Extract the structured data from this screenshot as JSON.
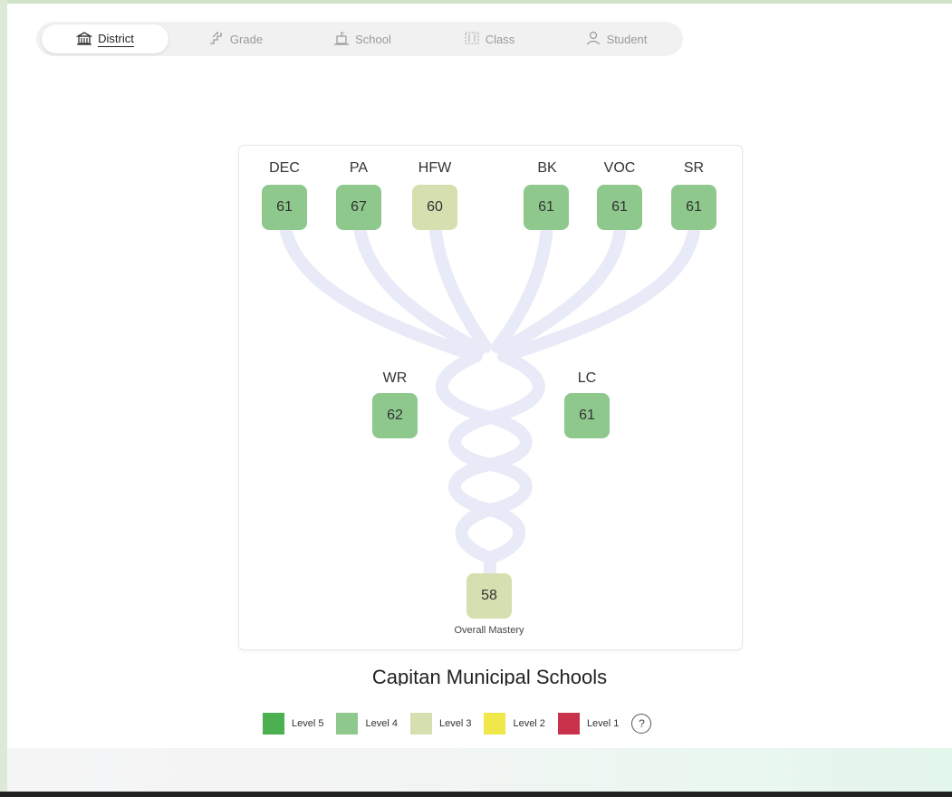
{
  "tabs": [
    {
      "id": "district",
      "label": "District",
      "icon": "building-icon",
      "active": true
    },
    {
      "id": "grade",
      "label": "Grade",
      "icon": "stairs-icon",
      "active": false
    },
    {
      "id": "school",
      "label": "School",
      "icon": "school-icon",
      "active": false
    },
    {
      "id": "class",
      "label": "Class",
      "icon": "class-icon",
      "active": false
    },
    {
      "id": "student",
      "label": "Student",
      "icon": "person-icon",
      "active": false
    }
  ],
  "tree": {
    "top_nodes": [
      {
        "label": "DEC",
        "value": "61",
        "level": 4
      },
      {
        "label": "PA",
        "value": "67",
        "level": 4
      },
      {
        "label": "HFW",
        "value": "60",
        "level": 3
      },
      {
        "label": "BK",
        "value": "61",
        "level": 4
      },
      {
        "label": "VOC",
        "value": "61",
        "level": 4
      },
      {
        "label": "SR",
        "value": "61",
        "level": 4
      }
    ],
    "mid_nodes": [
      {
        "label": "WR",
        "value": "62",
        "level": 4
      },
      {
        "label": "LC",
        "value": "61",
        "level": 4
      }
    ],
    "root": {
      "value": "58",
      "level": 3,
      "caption": "Overall Mastery"
    }
  },
  "school_name": "Capitan Municipal Schools",
  "legend": [
    {
      "label": "Level 5",
      "color": "#4caf50"
    },
    {
      "label": "Level 4",
      "color": "#8ec88d"
    },
    {
      "label": "Level 3",
      "color": "#d5dfb0"
    },
    {
      "label": "Level 2",
      "color": "#f0e84a"
    },
    {
      "label": "Level 1",
      "color": "#c8324a"
    }
  ],
  "help_symbol": "?",
  "colors": {
    "level4": "#8ec88d",
    "level3": "#d5dfb0",
    "branch": "#e8ebf7"
  }
}
